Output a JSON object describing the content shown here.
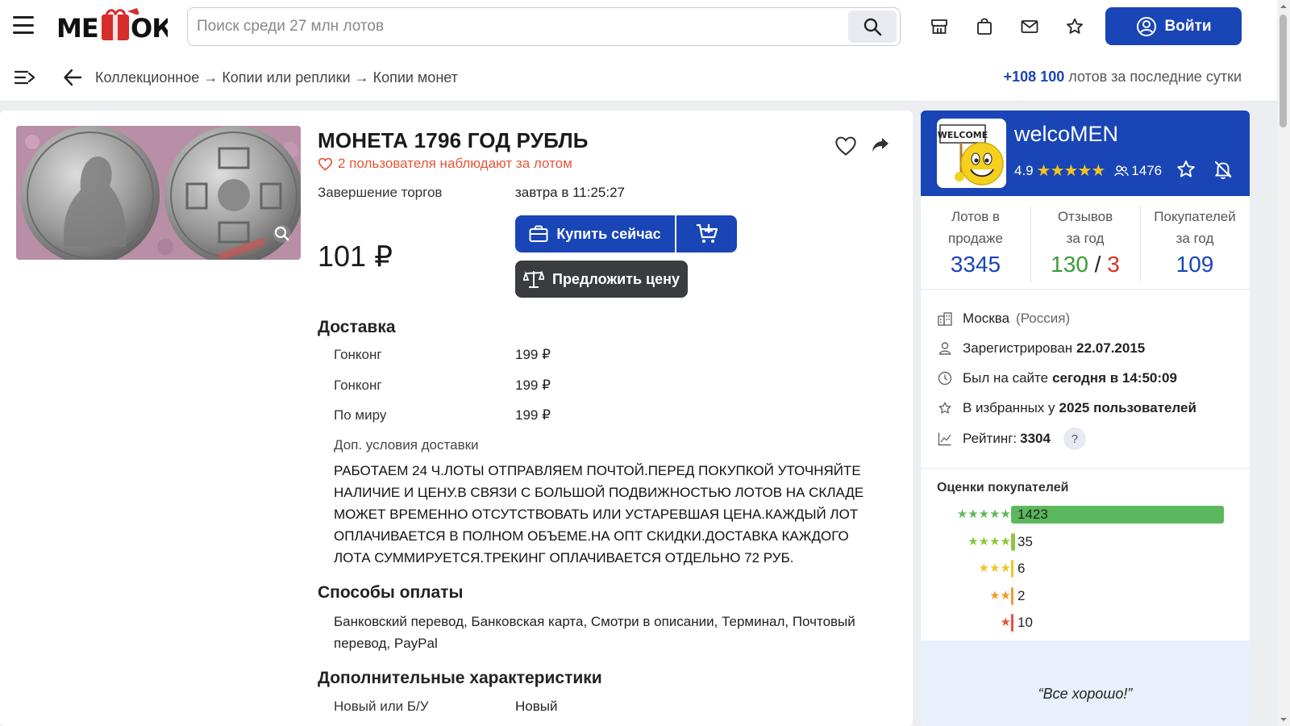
{
  "header": {
    "logo_text": "МЕШОК",
    "search_placeholder": "Поиск среди 27 млн лотов",
    "login_label": "Войти"
  },
  "breadcrumb": {
    "items": [
      "Коллекционное",
      "Копии или реплики",
      "Копии монет"
    ],
    "separator": "→",
    "counter_value": "+108 100",
    "counter_suffix": "лотов за последние сутки"
  },
  "lot": {
    "title": "МОНЕТА 1796 ГОД РУБЛЬ",
    "watchers": "2 пользователя наблюдают за лотом",
    "end_label": "Завершение торгов",
    "end_value": "завтра в 11:25:27",
    "price": "101 ₽",
    "buy_now_label": "Купить сейчас",
    "offer_label": "Предложить цену",
    "delivery_heading": "Доставка",
    "delivery": [
      {
        "region": "Гонконг",
        "price": "199 ₽"
      },
      {
        "region": "Гонконг",
        "price": "199 ₽"
      },
      {
        "region": "По миру",
        "price": "199 ₽"
      }
    ],
    "extra_delivery_label": "Доп. условия доставки",
    "extra_delivery_text": "РАБОТАЕМ 24 Ч.ЛОТЫ ОТПРАВЛЯЕМ ПОЧТОЙ.ПЕРЕД ПОКУПКОЙ УТОЧНЯЙТЕ НАЛИЧИЕ И ЦЕНУ.В СВЯЗИ С БОЛЬШОЙ ПОДВИЖНОСТЬЮ ЛОТОВ НА СКЛАДЕ МОЖЕТ ВРЕМЕННО ОТСУТСТВОВАТЬ ИЛИ УСТАРЕВШАЯ ЦЕНА.КАЖДЫЙ ЛОТ ОПЛАЧИВАЕТСЯ В ПОЛНОМ ОБЪЕМЕ.НА ОПТ СКИДКИ.ДОСТАВКА КАЖДОГО ЛОТА СУММИРУЕТСЯ.ТРЕКИНГ ОПЛАЧИВАЕТСЯ ОТДЕЛЬНО 72 РУБ.",
    "payment_heading": "Способы оплаты",
    "payment_text": "Банковский перевод, Банковская карта, Смотри в описании, Терминал, Почтовый перевод, PayPal",
    "characteristics_heading": "Дополнительные характеристики",
    "char_label": "Новый или Б/У",
    "char_value": "Новый"
  },
  "seller": {
    "avatar_text": "WELCOME",
    "name": "welcoMEN",
    "rating": "4.9",
    "followers": "1476",
    "stats": [
      {
        "label": "Лотов в продаже",
        "value": "3345"
      },
      {
        "label": "Отзывов за год",
        "positive": "130",
        "separator": "/",
        "negative": "3"
      },
      {
        "label": "Покупателей за год",
        "value": "109"
      }
    ],
    "city": "Москва",
    "country": "(Россия)",
    "registered_label": "Зарегистрирован",
    "registered_value": "22.07.2015",
    "last_seen_label": "Был на сайте",
    "last_seen_value": "сегодня в 14:50:09",
    "favorites_label": "В избранных у",
    "favorites_value": "2025 пользователей",
    "rating_label": "Рейтинг:",
    "rating_value": "3304",
    "help_label": "?",
    "reviews_heading": "Оценки покупателей",
    "reviews": [
      {
        "stars": 5,
        "count": "1423",
        "fraction": 1.0,
        "color": "#5cb85c"
      },
      {
        "stars": 4,
        "count": "35",
        "fraction": 0.02,
        "color": "#8dc63f"
      },
      {
        "stars": 3,
        "count": "6",
        "fraction": 0.01,
        "color": "#f2c12e"
      },
      {
        "stars": 2,
        "count": "2",
        "fraction": 0.01,
        "color": "#f29a2e"
      },
      {
        "stars": 1,
        "count": "10",
        "fraction": 0.01,
        "color": "#e5553a"
      }
    ],
    "quote": "“Все хорошо!”"
  },
  "colors": {
    "brand_blue": "#1945b6",
    "accent_red": "#e5553a",
    "positive_green": "#3a9a3a",
    "negative_red": "#d93025",
    "stat_blue": "#1945b6"
  }
}
